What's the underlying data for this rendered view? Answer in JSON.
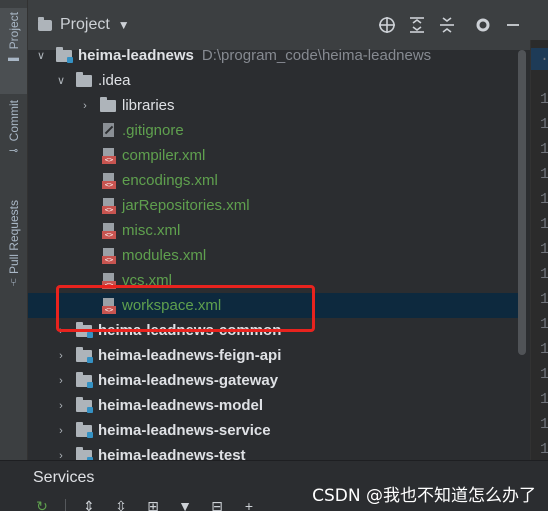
{
  "sidebar": {
    "tabs": [
      {
        "label": "Project"
      },
      {
        "label": "Commit"
      },
      {
        "label": "Pull Requests"
      }
    ]
  },
  "header": {
    "title": "Project",
    "tools": [
      "target-icon",
      "expand-all-icon",
      "collapse-all-icon",
      "gear-icon",
      "minimize-icon"
    ]
  },
  "tree": {
    "root": {
      "name": "heima-leadnews",
      "path": "D:\\program_code\\heima-leadnews"
    },
    "idea_folder": ".idea",
    "idea_children": [
      {
        "name": "libraries",
        "type": "folder"
      },
      {
        "name": ".gitignore",
        "type": "ignore"
      },
      {
        "name": "compiler.xml",
        "type": "xml"
      },
      {
        "name": "encodings.xml",
        "type": "xml"
      },
      {
        "name": "jarRepositories.xml",
        "type": "xml"
      },
      {
        "name": "misc.xml",
        "type": "xml"
      },
      {
        "name": "modules.xml",
        "type": "xml"
      },
      {
        "name": "vcs.xml",
        "type": "xml"
      },
      {
        "name": "workspace.xml",
        "type": "xml",
        "selected": true
      }
    ],
    "modules": [
      {
        "name": "heima-leadnews-common"
      },
      {
        "name": "heima-leadnews-feign-api"
      },
      {
        "name": "heima-leadnews-gateway"
      },
      {
        "name": "heima-leadnews-model"
      },
      {
        "name": "heima-leadnews-service"
      },
      {
        "name": "heima-leadnews-test"
      }
    ]
  },
  "editor": {
    "line_numbers": [
      ".",
      "1",
      "1",
      "1",
      "1",
      "1",
      "1",
      "1",
      "1",
      "1",
      "1",
      "1",
      "1",
      "1",
      "1",
      "1"
    ]
  },
  "services": {
    "title": "Services"
  },
  "watermark": "CSDN @我也不知道怎么办了",
  "colors": {
    "background": "#2b2d30",
    "selection": "#0d293e",
    "highlight_box": "#e8231e",
    "file_text_green": "#5fa04e"
  }
}
